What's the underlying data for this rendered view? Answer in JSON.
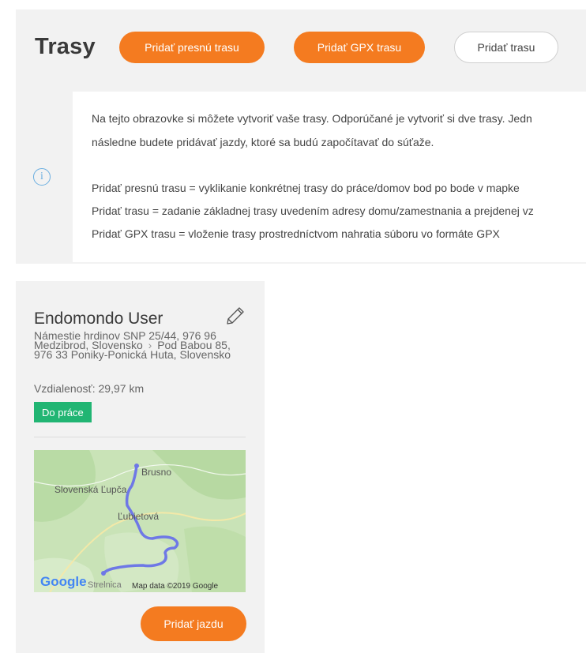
{
  "header": {
    "title": "Trasy",
    "buttons": {
      "add_precise": "Pridať presnú trasu",
      "add_gpx": "Pridať GPX trasu",
      "add_plain": "Pridať trasu"
    }
  },
  "info": {
    "icon": "info-circle-icon",
    "lines": [
      "Na tejto obrazovke si môžete vytvoriť vaše trasy. Odporúčané je vytvoriť si dve trasy. Jedn",
      "následne budete pridávať jazdy, ktoré sa budú započítavať do súťaže.",
      "Pridať presnú trasu = vyklikanie konkrétnej trasy do práce/domov bod po bode v mapke",
      "Pridať trasu = zadanie základnej trasy uvedením adresy domu/zamestnania a prejdenej vz",
      "Pridať GPX trasu = vloženie trasy prostredníctvom nahratia súboru vo formáte GPX"
    ]
  },
  "route_card": {
    "name": "Endomondo User",
    "from_address": "Námestie hrdinov SNP 25/44, 976 96 Medzibrod, Slovensko",
    "separator": "›",
    "to_address": "Pod Babou 85, 976 33 Poniky-Ponická Huta, Slovensko",
    "distance": "Vzdialenosť: 29,97 km",
    "badge": "Do práce",
    "map": {
      "places": [
        "Brusno",
        "Slovenská Ľupča",
        "Ľubietová"
      ],
      "partial_place": "Strelnica",
      "logo": "Google",
      "attribution": "Map data ©2019 Google"
    },
    "add_ride_label": "Pridať jazdu"
  },
  "colors": {
    "accent": "#f47b20",
    "badge": "#21b573",
    "route_line": "#6e78e6",
    "info_icon": "#6aaee0",
    "panel_bg": "#f2f2f2"
  }
}
